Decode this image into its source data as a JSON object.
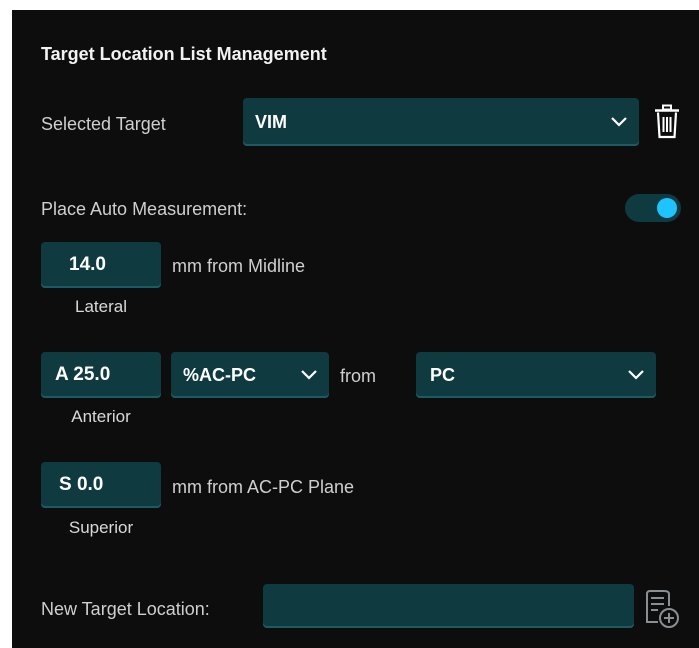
{
  "panel": {
    "title": "Target Location List Management",
    "selected_target_label": "Selected Target",
    "selected_target_value": "VIM",
    "place_auto_label": "Place Auto Measurement:",
    "auto_measurement_enabled": true,
    "lateral": {
      "value": "14.0",
      "unit_text": "mm from Midline",
      "caption": "Lateral"
    },
    "anterior": {
      "value": "A 25.0",
      "unit_select": "%AC-PC",
      "from_text": "from",
      "ref_select": "PC",
      "caption": "Anterior"
    },
    "superior": {
      "value": "S 0.0",
      "unit_text": "mm from AC-PC Plane",
      "caption": "Superior"
    },
    "new_target_label": "New Target Location:",
    "new_target_value": ""
  },
  "icons": {
    "delete": "trash-icon",
    "add": "add-document-icon",
    "dropdown": "chevron-down-icon"
  },
  "colors": {
    "panel_bg": "#0d0d0d",
    "field_bg": "#0f3a40",
    "accent": "#1fc3ff"
  }
}
